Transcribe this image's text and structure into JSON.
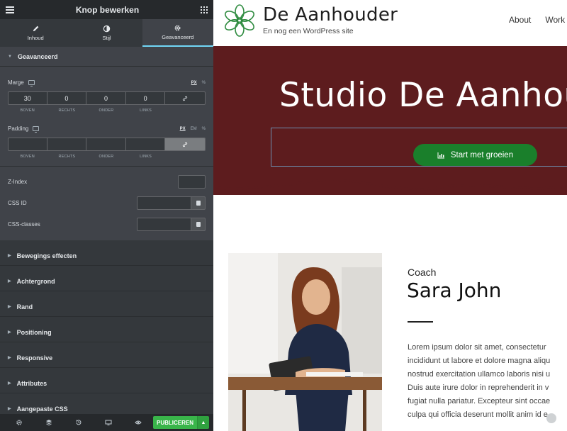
{
  "editor": {
    "title": "Knop bewerken",
    "tabs": [
      {
        "label": "Inhoud",
        "icon": "pencil-icon"
      },
      {
        "label": "Stijl",
        "icon": "contrast-icon"
      },
      {
        "label": "Geavanceerd",
        "icon": "gear-icon"
      }
    ],
    "active_tab": "Geavanceerd",
    "section_open": "Geavanceerd",
    "margin": {
      "label": "Marge",
      "units": [
        "PX",
        "%"
      ],
      "active_unit": "PX",
      "values": [
        "30",
        "0",
        "0",
        "0"
      ],
      "captions": [
        "BOVEN",
        "RECHTS",
        "ONDER",
        "LINKS"
      ]
    },
    "padding": {
      "label": "Padding",
      "units": [
        "PX",
        "EM",
        "%"
      ],
      "active_unit": "PX",
      "values": [
        "",
        "",
        "",
        ""
      ],
      "captions": [
        "BOVEN",
        "RECHTS",
        "ONDER",
        "LINKS"
      ]
    },
    "zindex_label": "Z-Index",
    "cssid_label": "CSS ID",
    "cssclasses_label": "CSS-classes",
    "sections": [
      "Bewegings effecten",
      "Achtergrond",
      "Rand",
      "Positioning",
      "Responsive",
      "Attributes",
      "Aangepaste CSS"
    ],
    "publish_label": "PUBLICEREN",
    "accent_color": "#71d7f7",
    "publish_color": "#39b54a"
  },
  "site": {
    "brand_name": "De Aanhouder",
    "tagline": "En nog een WordPress site",
    "nav": [
      "About",
      "Work"
    ],
    "hero_title": "Studio De Aanhouder",
    "cta_label": "Start met groeien",
    "role": "Coach",
    "person": "Sara John",
    "lorem": [
      "Lorem ipsum dolor sit amet, consectetur",
      "incididunt ut labore et dolore magna aliqu",
      "nostrud exercitation ullamco laboris nisi u",
      "Duis aute irure dolor in reprehenderit in v",
      "fugiat nulla pariatur. Excepteur sint occae",
      "culpa qui officia deserunt mollit anim id e"
    ],
    "hero_color": "#5d1c1e",
    "cta_color": "#1a7f2b"
  }
}
